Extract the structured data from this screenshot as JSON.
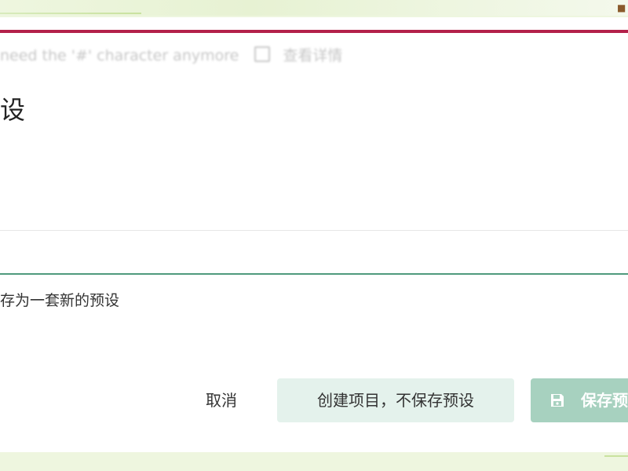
{
  "background_hint": {
    "text": "need the '#' character anymore",
    "link": "查看详情"
  },
  "section": {
    "title": "设"
  },
  "save_preset": {
    "label": "存为一套新的预设"
  },
  "actions": {
    "cancel_label": "取消",
    "create_without_save_label": "创建项目，不保存预设",
    "save_label": "保存预"
  },
  "colors": {
    "accent_top_bar": "#b3204a",
    "divider_green": "#4f9a7c",
    "secondary_button_bg": "#e4f2ec",
    "primary_button_bg": "#a7d1bf",
    "page_background": "#eef6df"
  },
  "icons": {
    "save": "floppy-disk-icon",
    "external_link": "external-link-icon",
    "corner": "stamp-icon"
  }
}
